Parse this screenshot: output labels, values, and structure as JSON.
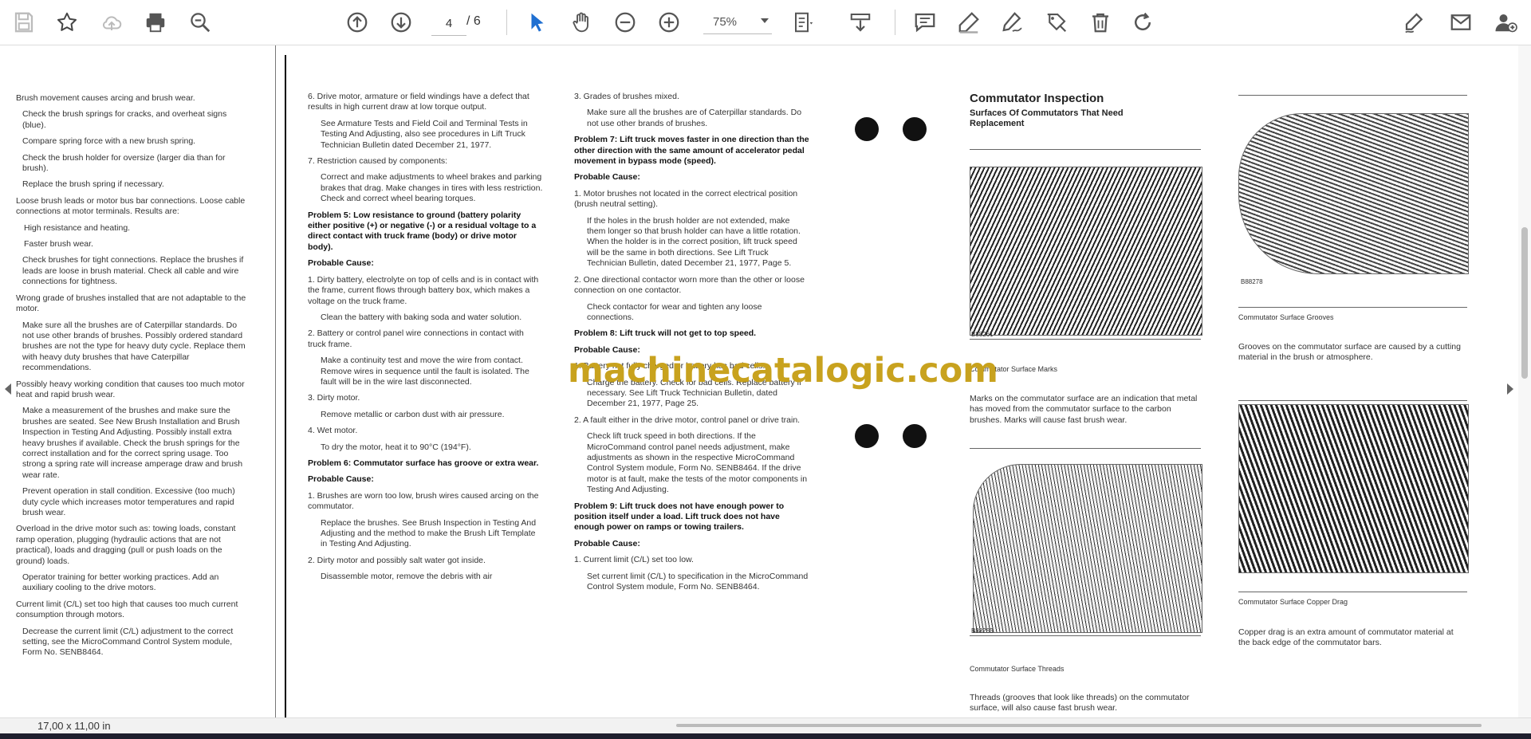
{
  "toolbar": {
    "page_current": "4",
    "page_total": "/ 6",
    "zoom": "75%",
    "icons": [
      "save-icon",
      "bookmark-star-icon",
      "upload-cloud-icon",
      "print-icon",
      "zoom-out-magnifier-icon",
      "page-up-icon",
      "page-down-icon",
      "select-cursor-icon",
      "hand-pan-icon",
      "zoom-minus-icon",
      "zoom-plus-icon",
      "fit-page-icon",
      "scroll-mode-icon",
      "comment-icon",
      "highlight-pen-icon",
      "draw-sign-icon",
      "edit-tag-icon",
      "delete-trash-icon",
      "rotate-icon",
      "fill-sign-icon",
      "email-icon",
      "add-user-icon"
    ]
  },
  "document": {
    "col1": [
      "Brush movement causes arcing and brush wear.",
      "Check the brush springs for cracks, and overheat signs (blue).",
      "Compare spring force with a new brush spring.",
      "Check the brush holder for oversize (larger dia than for brush).",
      "Replace the brush spring if necessary.",
      "Loose brush leads or motor bus bar connections. Loose cable connections at motor terminals. Results are:",
      "High resistance and heating.",
      "Faster brush wear.",
      "Check brushes for tight connections. Replace the brushes if leads are loose in brush material. Check all cable and wire connections for tightness.",
      "Wrong grade of brushes installed that are not adaptable to the motor.",
      "Make sure all the brushes are of Caterpillar standards. Do not use other brands of brushes. Possibly ordered standard brushes are not the type for heavy duty cycle. Replace them with heavy duty brushes that have Caterpillar recommendations.",
      "Possibly heavy working condition that causes too much motor heat and rapid brush wear.",
      "Make a measurement of the brushes and make sure the brushes are seated. See New Brush Installation and Brush Inspection in Testing And Adjusting. Possibly install extra heavy brushes if available. Check the brush springs for the correct installation and for the correct spring usage. Too strong a spring rate will increase amperage draw and brush wear rate.",
      "Prevent operation in stall condition. Excessive (too much) duty cycle which increases motor temperatures and rapid brush wear.",
      "Overload in the drive motor such as: towing loads, constant ramp operation, plugging (hydraulic actions that are not practical), loads and dragging (pull or push loads on the ground) loads.",
      "Operator training for better working practices. Add an auxiliary cooling to the drive motors.",
      "Current limit (C/L) set too high that causes too much current consumption through motors.",
      "Decrease the current limit (C/L) adjustment to the correct setting, see the MicroCommand Control System module, Form No. SENB8464."
    ],
    "col2": [
      "6. Drive motor, armature or field windings have a defect that results in high current draw at low torque output.",
      "See Armature Tests and Field Coil and Terminal Tests in Testing And Adjusting, also see procedures in Lift Truck Technician Bulletin dated December 21, 1977.",
      "7. Restriction caused by components:",
      "Correct and make adjustments to wheel brakes and parking brakes that drag. Make changes in tires with less restriction. Check and correct wheel bearing torques.",
      "Problem 5: Low resistance to ground (battery polarity either positive (+) or negative (-) or a residual voltage to a direct contact with truck frame (body) or drive motor body).",
      "Probable Cause:",
      "1. Dirty battery, electrolyte on top of cells and is in contact with the frame, current flows through battery box, which makes a voltage on the truck frame.",
      "Clean the battery with baking soda and water solution.",
      "2. Battery or control panel wire connections in contact with truck frame.",
      "Make a continuity test and move the wire from contact. Remove wires in sequence until the fault is isolated. The fault will be in the wire last disconnected.",
      "3. Dirty motor.",
      "Remove metallic or carbon dust with air pressure.",
      "4. Wet motor.",
      "To dry the motor, heat it to 90°C (194°F).",
      "Problem 6: Commutator surface has groove or extra wear.",
      "Probable Cause:",
      "1. Brushes are worn too low, brush wires caused arcing on the commutator.",
      "Replace the brushes. See Brush Inspection in Testing And Adjusting and the method to make the Brush Lift Template in Testing And Adjusting.",
      "2. Dirty motor and possibly salt water got inside.",
      "Disassemble motor, remove the debris with air"
    ],
    "col3": [
      "3. Grades of brushes mixed.",
      "Make sure all the brushes are of Caterpillar standards. Do not use other brands of brushes.",
      "Problem 7: Lift truck moves faster in one direction than the other direction with the same amount of accelerator pedal movement in bypass mode (speed).",
      "Probable Cause:",
      "1. Motor brushes not located in the correct electrical position (brush neutral setting).",
      "If the holes in the brush holder are not extended, make them longer so that brush holder can have a little rotation. When the holder is in the correct position, lift truck speed will be the same in both directions. See Lift Truck Technician Bulletin, dated December 21, 1977, Page 5.",
      "2. One directional contactor worn more than the other or loose connection on one contactor.",
      "Check contactor for wear and tighten any loose connections.",
      "Problem 8: Lift truck will not get to top speed.",
      "Probable Cause:",
      "1. Battery not fully charged or battery has bad cells.",
      "Charge the battery. Check for bad cells. Replace battery if necessary. See Lift Truck Technician Bulletin, dated December 21, 1977, Page 25.",
      "2. A fault either in the drive motor, control panel or drive train.",
      "Check lift truck speed in both directions. If the MicroCommand control panel needs adjustment, make adjustments as shown in the respective MicroCommand Control System module, Form No. SENB8464. If the drive motor is at fault, make the tests of the motor components in Testing And Adjusting.",
      "Problem 9: Lift truck does not have enough power to position itself under a load. Lift truck does not have enough power on ramps or towing trailers.",
      "Probable Cause:",
      "1. Current limit (C/L) set too low.",
      "Set current limit (C/L) to specification in the MicroCommand Control System module, Form No. SENB8464."
    ],
    "col4": {
      "title": "Commutator Inspection",
      "subtitle": "Surfaces Of Commutators That Need Replacement",
      "cap1": "Commutator Surface Marks",
      "para1": "Marks on the commutator surface are an indication that metal has moved from the commutator surface to the carbon brushes. Marks will cause fast brush wear.",
      "cap2": "Commutator Surface Threads",
      "para2": "Threads (grooves that look like threads) on the commutator surface, will also cause fast brush wear.",
      "code1": "B88261",
      "code2": "B88263"
    },
    "col5": {
      "cap1": "Commutator Surface Grooves",
      "para1": "Grooves on the commutator surface are caused by a cutting material in the brush or atmosphere.",
      "cap2": "Commutator Surface Copper Drag",
      "para2": "Copper drag is an extra amount of commutator material at the back edge of the commutator bars.",
      "code1": "B88278"
    }
  },
  "watermark": "machinecatalogic.com",
  "status": {
    "page_size": "17,00 x 11,00 in"
  }
}
